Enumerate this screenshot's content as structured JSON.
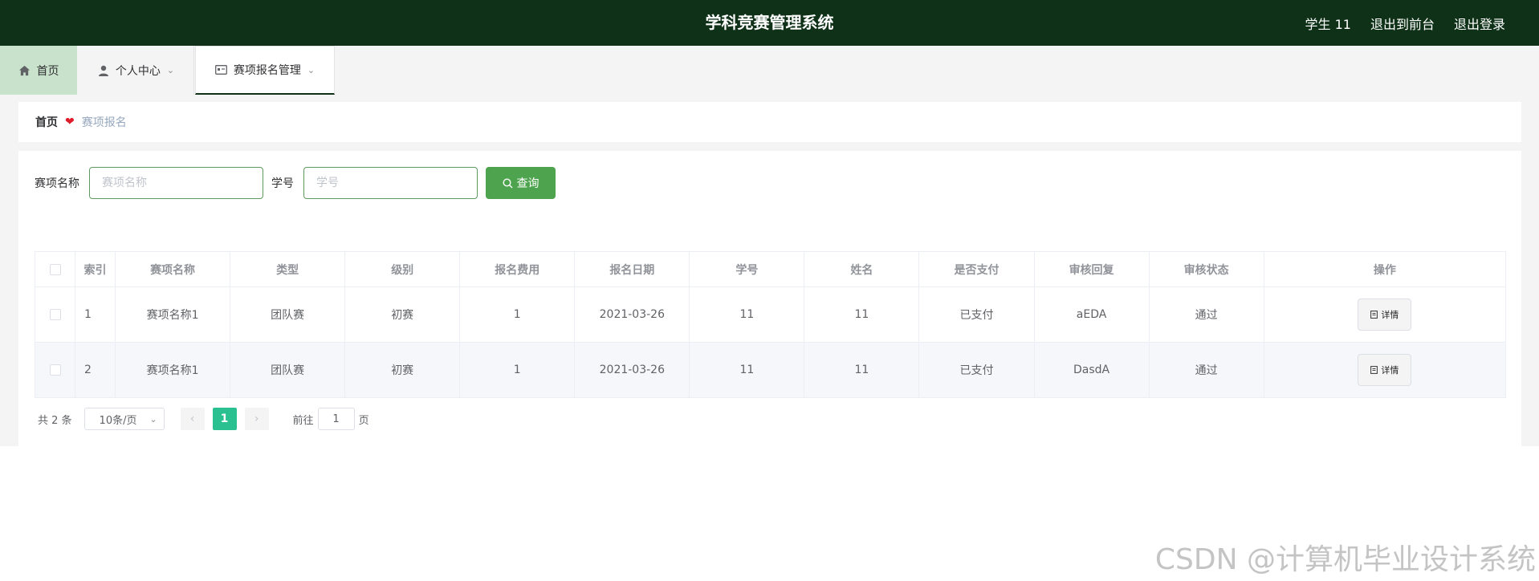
{
  "header": {
    "title": "学科竞赛管理系统",
    "user": "学生 11",
    "to_front": "退出到前台",
    "logout": "退出登录"
  },
  "nav": {
    "items": [
      {
        "label": "首页",
        "icon": "home-icon"
      },
      {
        "label": "个人中心",
        "icon": "user-icon"
      },
      {
        "label": "赛项报名管理",
        "icon": "card-icon"
      }
    ]
  },
  "breadcrumb": {
    "home": "首页",
    "current": "赛项报名"
  },
  "search": {
    "name_label": "赛项名称",
    "name_placeholder": "赛项名称",
    "id_label": "学号",
    "id_placeholder": "学号",
    "button_label": "查询"
  },
  "table": {
    "headers": [
      "索引",
      "赛项名称",
      "类型",
      "级别",
      "报名费用",
      "报名日期",
      "学号",
      "姓名",
      "是否支付",
      "审核回复",
      "审核状态",
      "操作"
    ],
    "rows": [
      {
        "index": "1",
        "name": "赛项名称1",
        "type": "团队赛",
        "level": "初赛",
        "fee": "1",
        "date": "2021-03-26",
        "student_id": "11",
        "student_name": "11",
        "paid": "已支付",
        "reply": "aEDA",
        "status": "通过",
        "action": "详情"
      },
      {
        "index": "2",
        "name": "赛项名称1",
        "type": "团队赛",
        "level": "初赛",
        "fee": "1",
        "date": "2021-03-26",
        "student_id": "11",
        "student_name": "11",
        "paid": "已支付",
        "reply": "DasdA",
        "status": "通过",
        "action": "详情"
      }
    ]
  },
  "pagination": {
    "total": "共 2 条",
    "page_size": "10条/页",
    "current_page": "1",
    "goto_label": "前往",
    "goto_value": "1",
    "page_suffix": "页"
  },
  "watermark": "CSDN @计算机毕业设计系统",
  "colors": {
    "header_bg": "#0e3118",
    "accent": "#4ea44e",
    "page_active": "#2ac08f",
    "heart": "#e01b2a"
  }
}
